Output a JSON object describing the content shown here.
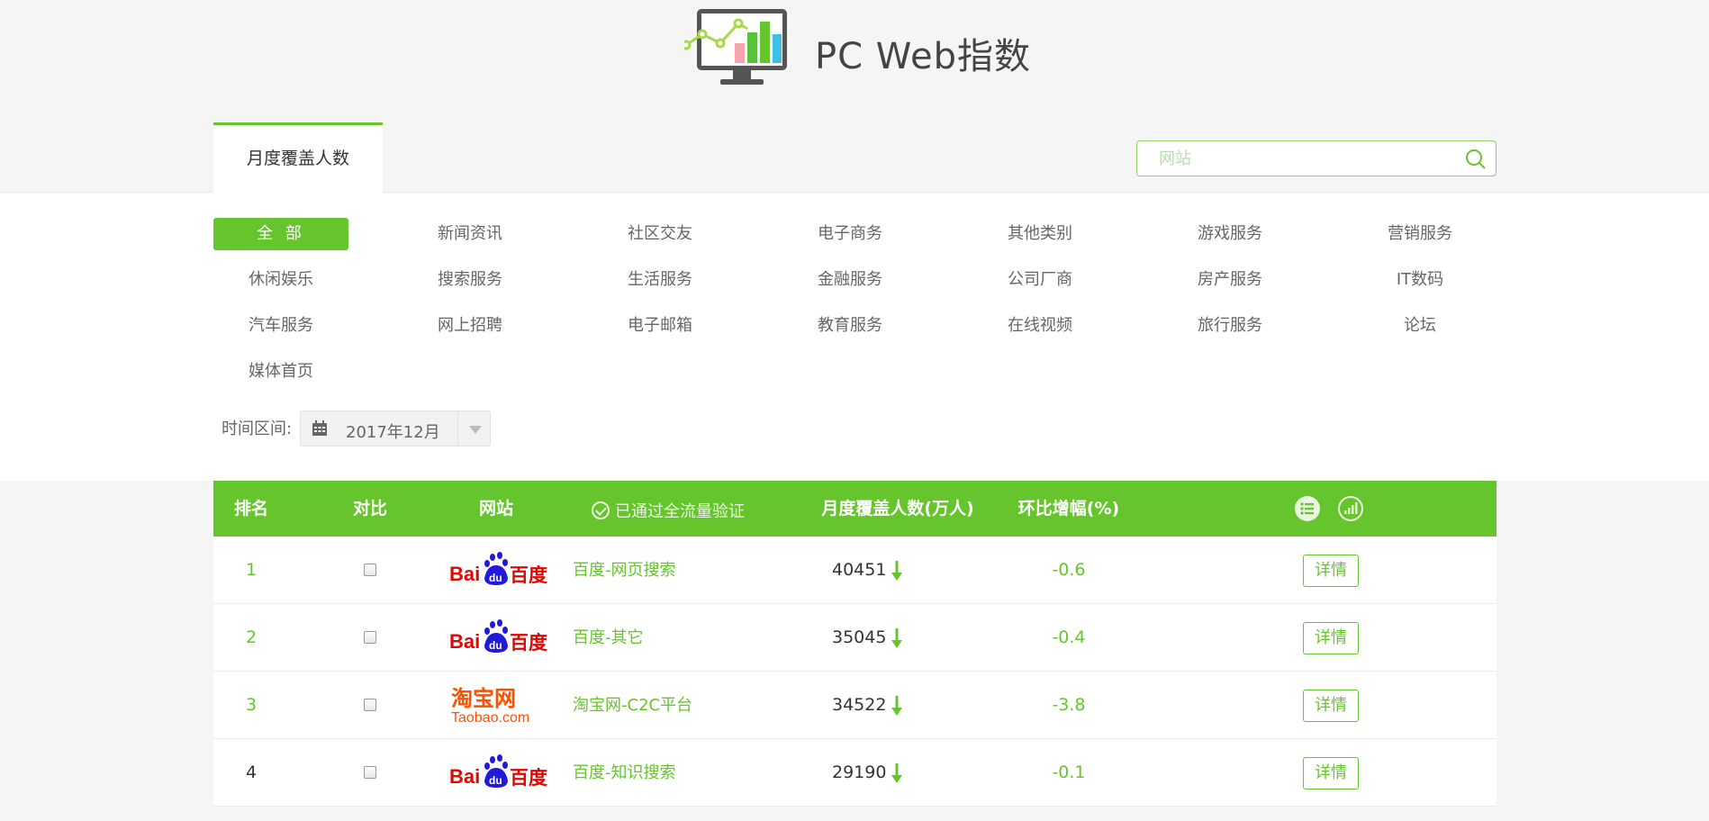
{
  "header": {
    "title": "PC Web指数"
  },
  "tabs": {
    "active_label": "月度覆盖人数"
  },
  "search": {
    "placeholder": "网站"
  },
  "categories": [
    "全 部",
    "新闻资讯",
    "社区交友",
    "电子商务",
    "其他类别",
    "游戏服务",
    "营销服务",
    "休闲娱乐",
    "搜索服务",
    "生活服务",
    "金融服务",
    "公司厂商",
    "房产服务",
    "IT数码",
    "汽车服务",
    "网上招聘",
    "电子邮箱",
    "教育服务",
    "在线视频",
    "旅行服务",
    "论坛",
    "媒体首页"
  ],
  "filter": {
    "time_label": "时间区间:",
    "date_value": "2017年12月"
  },
  "table": {
    "headers": {
      "rank": "排名",
      "compare": "对比",
      "site": "网站",
      "verified": "已通过全流量验证",
      "coverage": "月度覆盖人数(万人)",
      "change": "环比增幅(%)"
    },
    "detail_label": "详情",
    "rows": [
      {
        "rank": "1",
        "logo": "baidu-logo",
        "name": "百度-网页搜索",
        "value": "40451",
        "change": "-0.6"
      },
      {
        "rank": "2",
        "logo": "baidu-logo",
        "name": "百度-其它",
        "value": "35045",
        "change": "-0.4"
      },
      {
        "rank": "3",
        "logo": "taobao-logo",
        "name": "淘宝网-C2C平台",
        "value": "34522",
        "change": "-3.8"
      },
      {
        "rank": "4",
        "logo": "baidu-logo",
        "name": "百度-知识搜索",
        "value": "29190",
        "change": "-0.1"
      }
    ]
  },
  "logos": {
    "baidu_text_left": "Bai",
    "baidu_paw_text": "du",
    "baidu_text_right": "百度",
    "taobao_cn": "淘宝网",
    "taobao_en": "Taobao.com"
  },
  "colors": {
    "accent": "#66c42d",
    "baidu_red": "#e10601",
    "baidu_blue": "#2319dc",
    "taobao_orange": "#ff5000"
  }
}
